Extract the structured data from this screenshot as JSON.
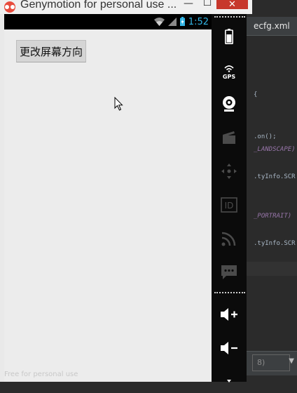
{
  "window": {
    "title": "Genymotion for personal use ...",
    "minimize": "—",
    "maximize": "☐",
    "close": "✕"
  },
  "status_bar": {
    "time": "1:52"
  },
  "app": {
    "rotate_button_label": "更改屏幕方向",
    "watermark": "Free for personal use"
  },
  "toolbar": {
    "items": [
      {
        "name": "battery-icon",
        "enabled": true
      },
      {
        "name": "gps-icon",
        "label": "GPS",
        "enabled": true
      },
      {
        "name": "webcam-icon",
        "enabled": true
      },
      {
        "name": "screencast-icon",
        "enabled": false
      },
      {
        "name": "remote-control-icon",
        "enabled": false
      },
      {
        "name": "device-id-icon",
        "label": "ID",
        "enabled": false
      },
      {
        "name": "network-icon",
        "enabled": false
      },
      {
        "name": "sms-icon",
        "enabled": false
      },
      {
        "name": "volume-up-icon",
        "enabled": true
      },
      {
        "name": "volume-down-icon",
        "enabled": true
      },
      {
        "name": "more-icon",
        "enabled": true
      }
    ]
  },
  "ide": {
    "tab_label": "ecfg.xml",
    "lines": [
      {
        "text": "{"
      },
      {
        "text": ".on();"
      },
      {
        "text": "_LANDSCAPE)",
        "style": "purple"
      },
      {
        "text": ".tyInfo.SCR"
      },
      {
        "text": "_PORTRAIT)",
        "style": "purple"
      },
      {
        "text": ".tyInfo.SCR"
      }
    ],
    "combo_value": "8)",
    "combo_arrow": "▼"
  },
  "colors": {
    "close_button": "#c7372c",
    "status_time": "#33b5e5",
    "toolbar_bg": "#0b0b0b"
  }
}
